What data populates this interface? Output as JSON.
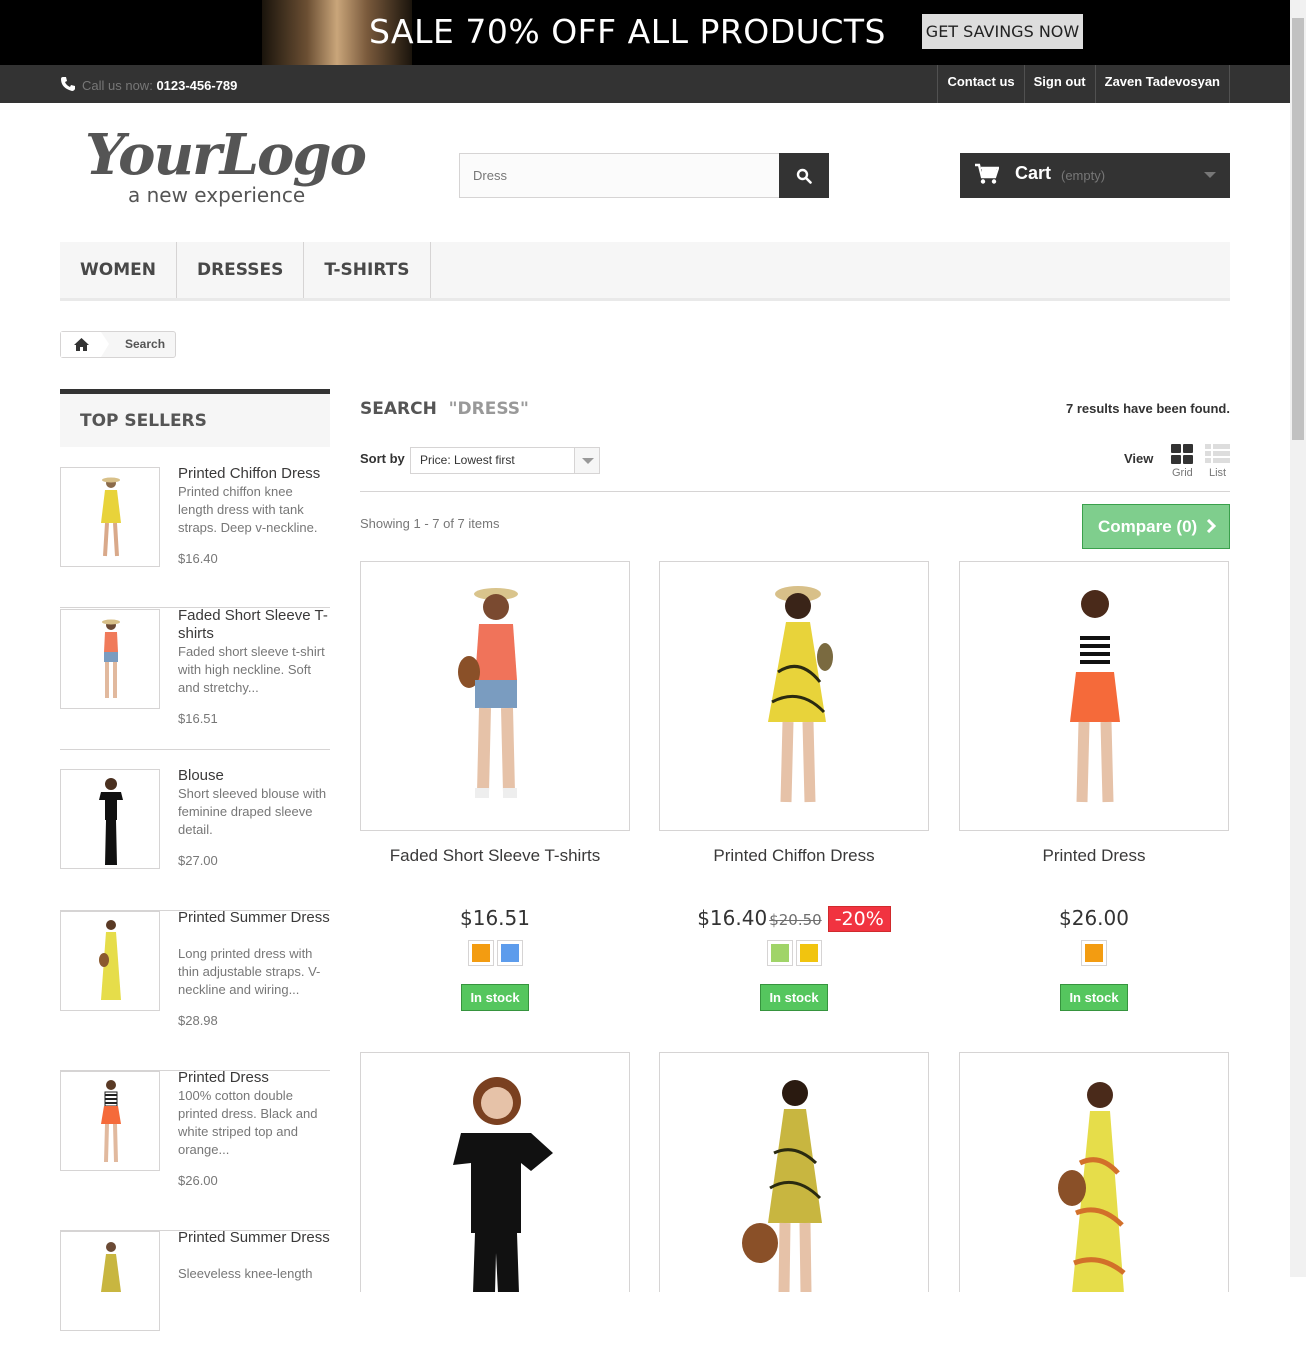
{
  "banner": {
    "title": "SALE 70% OFF ALL PRODUCTS",
    "button": "GET SAVINGS NOW"
  },
  "topbar": {
    "call_label": "Call us now:",
    "phone": "0123-456-789",
    "links": [
      "Contact us",
      "Sign out",
      "Zaven Tadevosyan"
    ]
  },
  "logo": {
    "word": "YourLogo",
    "tagline": "a new experience"
  },
  "search": {
    "value": "Dress"
  },
  "cart": {
    "label": "Cart",
    "status": "(empty)"
  },
  "menu": [
    "WOMEN",
    "DRESSES",
    "T-SHIRTS"
  ],
  "breadcrumb": {
    "current": "Search"
  },
  "sidebar": {
    "title": "TOP SELLERS",
    "items": [
      {
        "name": "Printed Chiffon Dress",
        "desc": "Printed chiffon knee length dress with tank straps. Deep v-neckline.",
        "price": "$16.40"
      },
      {
        "name": "Faded Short Sleeve T-shirts",
        "desc": "Faded short sleeve t-shirt with high neckline. Soft and stretchy...",
        "price": "$16.51"
      },
      {
        "name": "Blouse",
        "desc": "Short sleeved blouse with feminine draped sleeve detail.",
        "price": "$27.00"
      },
      {
        "name": "Printed Summer Dress",
        "desc": "Long printed dress with thin adjustable straps. V-neckline and wiring...",
        "price": "$28.98"
      },
      {
        "name": "Printed Dress",
        "desc": "100% cotton double printed dress. Black and white striped top and orange...",
        "price": "$26.00"
      },
      {
        "name": "Printed Summer Dress",
        "desc": "Sleeveless knee-length",
        "price": ""
      }
    ]
  },
  "main": {
    "heading": "SEARCH",
    "query": "\"DRESS\"",
    "results": "7 results have been found.",
    "sort_label": "Sort by",
    "sort_value": "Price: Lowest first",
    "view_label": "View",
    "grid_label": "Grid",
    "list_label": "List",
    "showing": "Showing 1 - 7 of 7 items",
    "compare": "Compare (0)",
    "products": [
      {
        "name": "Faded Short Sleeve T-shirts",
        "price": "$16.51",
        "old_price": "",
        "discount": "",
        "colors": [
          "#f39c11",
          "#5d9cec"
        ],
        "stock": "In stock"
      },
      {
        "name": "Printed Chiffon Dress",
        "price": "$16.40",
        "old_price": "$20.50",
        "discount": "-20%",
        "colors": [
          "#a0d468",
          "#f1c40f"
        ],
        "stock": "In stock"
      },
      {
        "name": "Printed Dress",
        "price": "$26.00",
        "old_price": "",
        "discount": "",
        "colors": [
          "#f39c11"
        ],
        "stock": "In stock"
      }
    ]
  },
  "colors": {
    "dark": "#333333",
    "green": "#55c65e",
    "red": "#f13340"
  }
}
